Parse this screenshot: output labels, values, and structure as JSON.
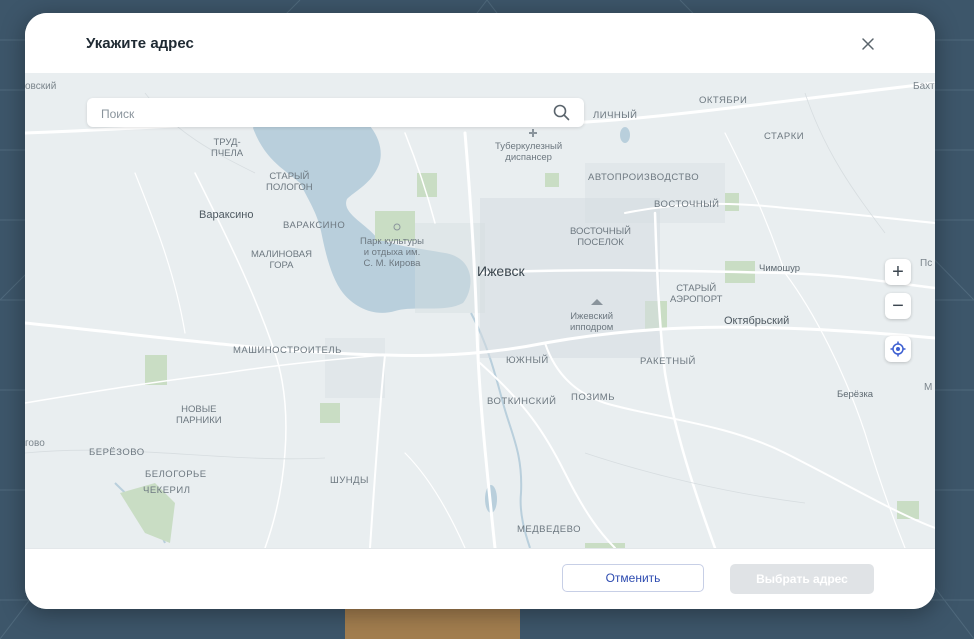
{
  "dialog": {
    "title": "Укажите адрес",
    "close_icon": "close-icon"
  },
  "search": {
    "placeholder": "Поиск",
    "icon": "search-icon"
  },
  "map": {
    "city_label": "Ижевск",
    "towns": [
      "Вараксино",
      "Октябрьский",
      "Чимошур",
      "Берёзка"
    ],
    "districts": [
      "ТРУД-\nПЧЕЛА",
      "СТАРЫЙ\nПОЛОГОН",
      "ВАРАКСИНО",
      "МАЛИНОВАЯ\nГОРА",
      "МАШИНОСТРОИТЕЛЬ",
      "НОВЫЕ\nПАРНИКИ",
      "БЕРЁЗОВО",
      "БЕЛОГОРЬЕ",
      "ЧЕКЕРИЛ",
      "ШУНДЫ",
      "ЮЖНЫЙ",
      "ВОТКИНСКИЙ",
      "ПОЗИМЬ",
      "МЕДВЕДЕВО",
      "РАКЕТНЫЙ",
      "СТАРЫЙ\nАЭРОПОРТ",
      "ВОСТОЧНЫЙ\nПОСЕЛОК",
      "ВОСТОЧНЫЙ",
      "АВТОПРОИЗВОДСТВО",
      "ОКТЯБРИ",
      "СТАРКИ",
      "ЛИЧНЫЙ"
    ],
    "pois": [
      "Туберкулезный\nдиспансер",
      "Парк культуры\nи отдыха им.\nС. М. Кирова",
      "Ижевский\nипподром"
    ],
    "edge_labels": [
      "овский",
      "Бахт",
      "Пс",
      "М",
      "гово"
    ],
    "colors": {
      "water": "#b9cfdc",
      "land": "#e9eef0",
      "green": "#c9ddc4",
      "road": "#ffffff"
    }
  },
  "controls": {
    "zoom_in": "+",
    "zoom_out": "−",
    "locate_icon": "locate-icon"
  },
  "footer": {
    "cancel_label": "Отменить",
    "select_label": "Выбрать адрес"
  }
}
